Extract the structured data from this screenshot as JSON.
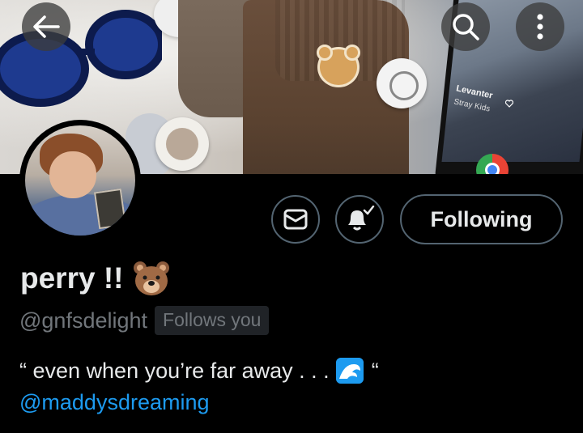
{
  "header": {
    "back_icon": "arrow-left-icon",
    "search_icon": "search-icon",
    "more_icon": "more-vertical-icon"
  },
  "banner": {
    "song_title": "Levanter",
    "song_artist": "Stray Kids"
  },
  "actions": {
    "message_icon": "mail-icon",
    "notify_icon": "bell-check-icon",
    "follow_label": "Following"
  },
  "profile": {
    "display_name": "perry !!",
    "name_emoji": "bear-face",
    "handle": "@gnfsdelight",
    "follows_badge": "Follows you",
    "bio_open_quote": "“ even when you’re far away . . .",
    "bio_emoji": "water-wave",
    "bio_close_quote": "“",
    "bio_mention": "@maddysdreaming"
  },
  "colors": {
    "background": "#000000",
    "text_primary": "#e7e9ea",
    "text_secondary": "#71767b",
    "accent": "#1d9bf0",
    "border": "#536471",
    "badge_bg": "#202327"
  }
}
